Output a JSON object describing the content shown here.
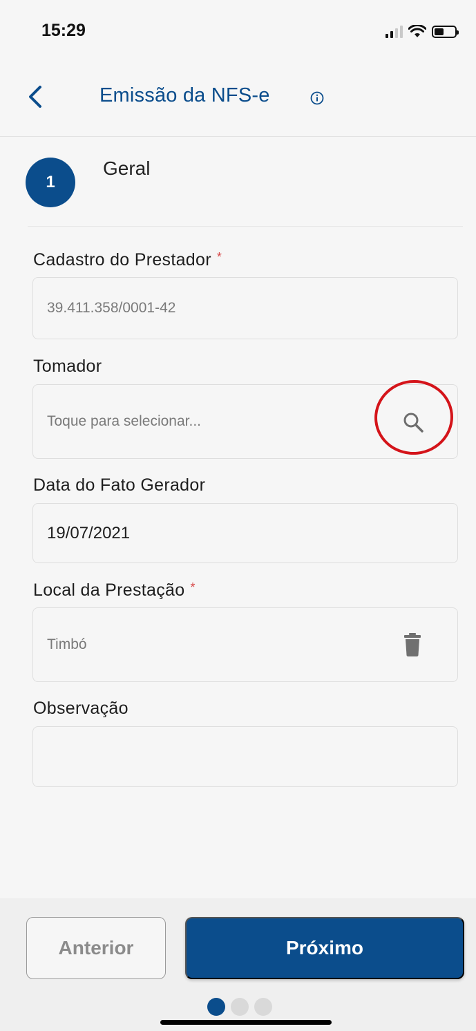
{
  "status_bar": {
    "time": "15:29"
  },
  "header": {
    "title": "Emissão da NFS-e"
  },
  "step": {
    "number": "1",
    "title": "Geral"
  },
  "fields": {
    "prestador": {
      "label": "Cadastro do Prestador",
      "required": "*",
      "value": "39.411.358/0001-42"
    },
    "tomador": {
      "label": "Tomador",
      "placeholder": "Toque para selecionar..."
    },
    "data": {
      "label": "Data do Fato Gerador",
      "value": "19/07/2021"
    },
    "local": {
      "label": "Local da Prestação",
      "required": "*",
      "value": "Timbó"
    },
    "observacao": {
      "label": "Observação",
      "value": ""
    }
  },
  "buttons": {
    "previous": "Anterior",
    "next": "Próximo"
  },
  "pagination": {
    "current": 1,
    "total": 3
  },
  "colors": {
    "primary": "#0b4d8c",
    "required": "#d64545",
    "annotation": "#d4141a"
  }
}
